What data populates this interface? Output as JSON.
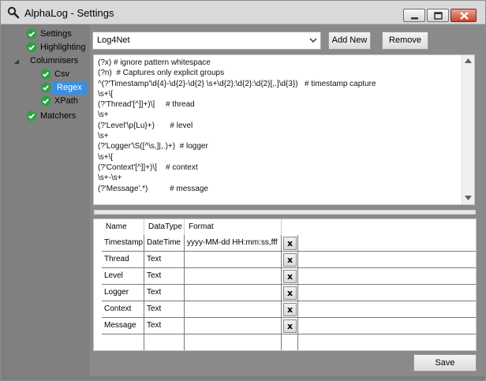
{
  "window": {
    "title": "AlphaLog - Settings"
  },
  "sidebar": {
    "items": [
      {
        "label": "Settings",
        "checked": true
      },
      {
        "label": "Highlighting",
        "checked": true
      },
      {
        "label": "Columnisers",
        "checked": false
      },
      {
        "label": "Csv",
        "checked": true
      },
      {
        "label": "Regex",
        "checked": true,
        "selected": true
      },
      {
        "label": "XPath",
        "checked": true
      },
      {
        "label": "Matchers",
        "checked": true
      }
    ]
  },
  "toolbar": {
    "pattern_value": "Log4Net",
    "add_new_label": "Add New",
    "remove_label": "Remove"
  },
  "regex": {
    "lines": [
      "(?x) # ignore pattern whitespace",
      "(?n)  # Captures only explicit groups",
      "^(?'Timestamp'\\d{4}-\\d{2}-\\d{2} \\s+\\d{2}:\\d{2}:\\d{2}[,.]\\d{3})   # timestamp capture",
      "\\s+\\[",
      "(?'Thread'[^]]+)\\]     # thread",
      "\\s+",
      "(?'Level'\\p{Lu}+)       # level",
      "\\s+",
      "(?'Logger'\\S([^\\s,]|,.)+)  # logger",
      "\\s+\\[",
      "(?'Context'[^]]+)\\]    # context",
      "\\s+-\\s+",
      "(?'Message'.*)          # message"
    ]
  },
  "grid": {
    "headers": [
      "Name",
      "DataType",
      "Format"
    ],
    "rows": [
      {
        "name": "Timestamp",
        "datatype": "DateTime",
        "format": "yyyy-MM-dd HH:mm:ss,fff",
        "delete": "x"
      },
      {
        "name": "Thread",
        "datatype": "Text",
        "format": "",
        "delete": "x"
      },
      {
        "name": "Level",
        "datatype": "Text",
        "format": "",
        "delete": "x"
      },
      {
        "name": "Logger",
        "datatype": "Text",
        "format": "",
        "delete": "x"
      },
      {
        "name": "Context",
        "datatype": "Text",
        "format": "",
        "delete": "x"
      },
      {
        "name": "Message",
        "datatype": "Text",
        "format": "",
        "delete": "x"
      }
    ]
  },
  "footer": {
    "save_label": "Save"
  },
  "colors": {
    "selection": "#3b8fe0",
    "check_green": "#2ea043",
    "close_red": "#c9462b"
  }
}
